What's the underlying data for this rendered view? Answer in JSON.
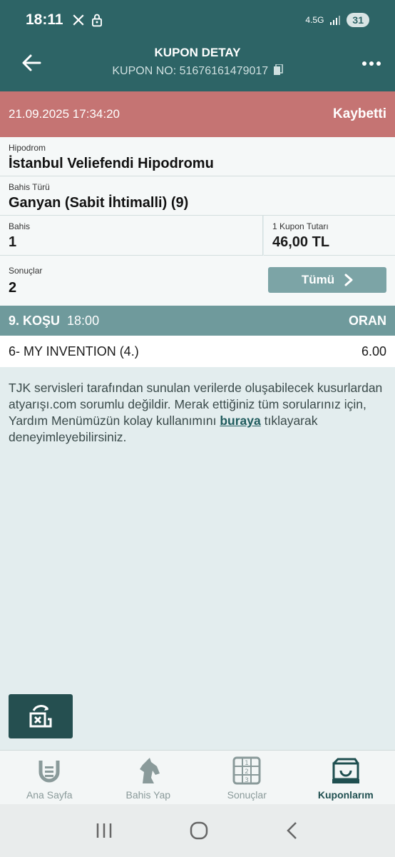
{
  "status_bar": {
    "time": "18:11",
    "network": "4.5G",
    "battery": "31"
  },
  "app_bar": {
    "title": "KUPON DETAY",
    "coupon_no": "KUPON NO: 51676161479017"
  },
  "coupon": {
    "datetime": "21.09.2025 17:34:20",
    "result": "Kaybetti",
    "hippodrome_label": "Hipodrom",
    "hippodrome_value": "İstanbul Veliefendi Hipodromu",
    "bet_type_label": "Bahis Türü",
    "bet_type_value": "Ganyan (Sabit İhtimalli) (9)",
    "bet_label": "Bahis",
    "bet_value": "1",
    "amount_label": "1 Kupon Tutarı",
    "amount_value": "46,00 TL",
    "results_label": "Sonuçlar",
    "results_value": "2",
    "all_button": "Tümü"
  },
  "race": {
    "name": "9. KOŞU",
    "time": "18:00",
    "odds_header": "ORAN",
    "selection": "6- MY INVENTION (4.)",
    "odds": "6.00"
  },
  "disclaimer": {
    "text_before": "TJK servisleri tarafından sunulan verilerde oluşabilecek kusurlardan atyarışı.com sorumlu değildir. Merak ettiğiniz tüm sorularınız için, Yardım Menümüzün kolay kullanımını ",
    "link": "buraya",
    "text_after": " tıklayarak deneyimleyebilirsiniz."
  },
  "bottom_nav": {
    "items": [
      {
        "label": "Ana Sayfa",
        "icon": "horseshoe-icon"
      },
      {
        "label": "Bahis Yap",
        "icon": "horse-head-icon"
      },
      {
        "label": "Sonuçlar",
        "icon": "results-grid-icon"
      },
      {
        "label": "Kuponlarım",
        "icon": "coupons-icon"
      }
    ],
    "active": 3
  },
  "colors": {
    "primary": "#2d6466",
    "lost": "#c57473",
    "race_header": "#6f9a9c",
    "button": "#7ca4a6"
  }
}
